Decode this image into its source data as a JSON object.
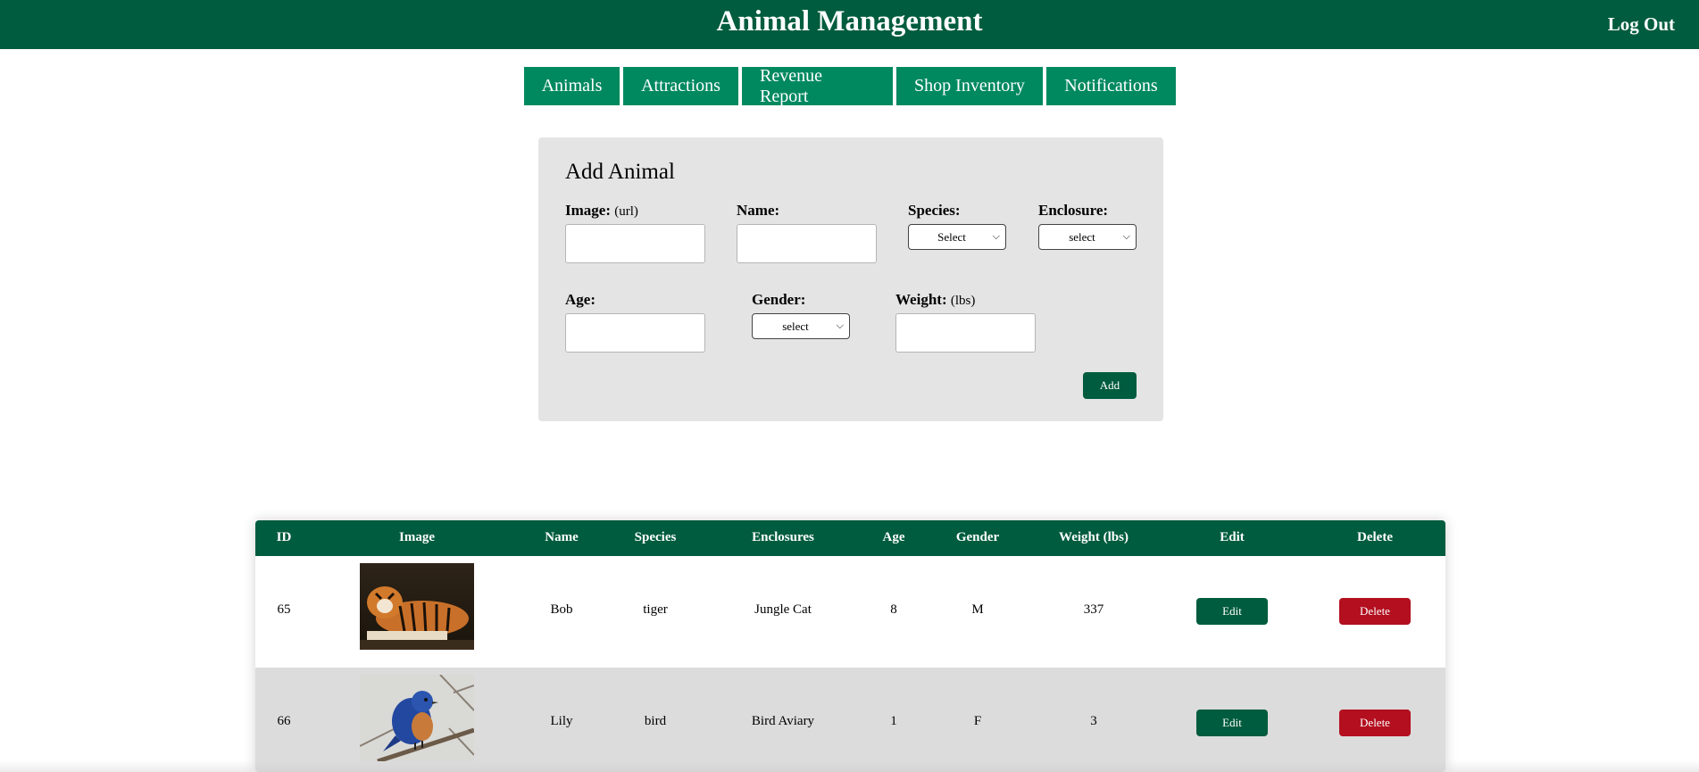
{
  "header": {
    "title": "Animal Management",
    "logout_label": "Log Out",
    "bg_color": "#005c3e"
  },
  "nav": {
    "tabs": [
      {
        "label": "Animals"
      },
      {
        "label": "Attractions"
      },
      {
        "label": "Revenue Report"
      },
      {
        "label": "Shop Inventory"
      },
      {
        "label": "Notifications"
      }
    ],
    "tab_color": "#00895f"
  },
  "form": {
    "title": "Add Animal",
    "image_label": "Image:",
    "image_hint": "(url)",
    "name_label": "Name:",
    "species_label": "Species:",
    "species_selected": "Select",
    "enclosure_label": "Enclosure:",
    "enclosure_selected": "select",
    "age_label": "Age:",
    "gender_label": "Gender:",
    "gender_selected": "select",
    "weight_label": "Weight:",
    "weight_hint": "(lbs)",
    "add_label": "Add"
  },
  "table": {
    "columns": [
      "ID",
      "Image",
      "Name",
      "Species",
      "Enclosures",
      "Age",
      "Gender",
      "Weight (lbs)",
      "Edit",
      "Delete"
    ],
    "rows": [
      {
        "id": "65",
        "image": "tiger-photo",
        "name": "Bob",
        "species": "tiger",
        "enclosure": "Jungle Cat",
        "age": "8",
        "gender": "M",
        "weight": "337",
        "edit_label": "Edit",
        "delete_label": "Delete"
      },
      {
        "id": "66",
        "image": "bird-photo",
        "name": "Lily",
        "species": "bird",
        "enclosure": "Bird Aviary",
        "age": "1",
        "gender": "F",
        "weight": "3",
        "edit_label": "Edit",
        "delete_label": "Delete"
      }
    ]
  },
  "colors": {
    "primary": "#005c3e",
    "danger": "#b30f1f",
    "form_bg": "#e4e4e4",
    "alt_row": "#dcdcdc"
  }
}
